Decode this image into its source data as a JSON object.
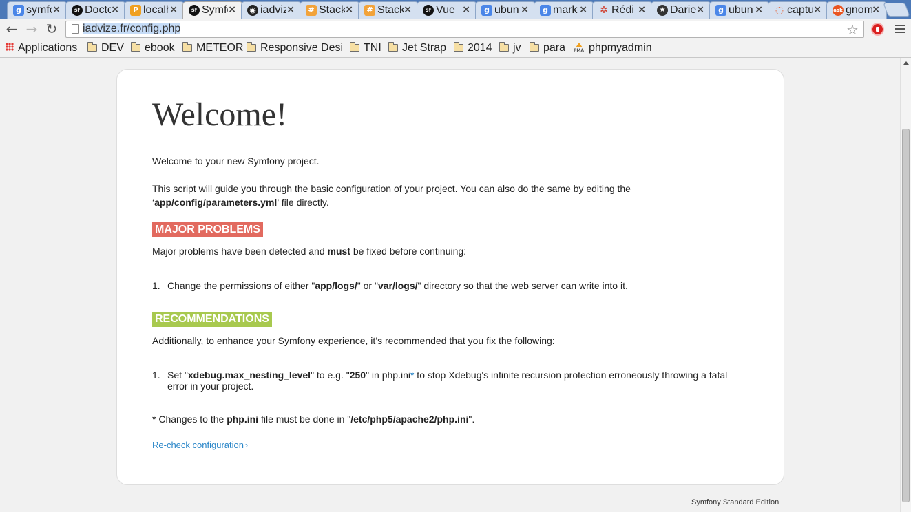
{
  "browser": {
    "tabs": [
      {
        "label": "symfo",
        "icon": "google-icon",
        "color": "#4a86e8",
        "glyph": "g"
      },
      {
        "label": "Docto",
        "icon": "symfony-icon",
        "color": "#111111",
        "glyph": "sf"
      },
      {
        "label": "localh",
        "icon": "phpmyadmin-icon",
        "color": "#f0a020",
        "glyph": "P"
      },
      {
        "label": "Symfo",
        "icon": "symfony-icon",
        "color": "#111111",
        "glyph": "sf",
        "active": true
      },
      {
        "label": "iadviz",
        "icon": "github-icon",
        "color": "#222222",
        "glyph": "◉"
      },
      {
        "label": "Stack",
        "icon": "stackoverflow-icon",
        "color": "#f2a33a",
        "glyph": "#"
      },
      {
        "label": "Stack",
        "icon": "stackoverflow-icon",
        "color": "#f2a33a",
        "glyph": "#"
      },
      {
        "label": "Vue",
        "icon": "symfony-icon",
        "color": "#111111",
        "glyph": "sf"
      },
      {
        "label": "ubun",
        "icon": "google-icon",
        "color": "#4a86e8",
        "glyph": "g"
      },
      {
        "label": "mark",
        "icon": "google-icon",
        "color": "#4a86e8",
        "glyph": "g"
      },
      {
        "label": "Rédi",
        "icon": "redis-icon",
        "color": "#d03f2f",
        "glyph": "✲"
      },
      {
        "label": "Darie",
        "icon": "star-icon",
        "color": "#333333",
        "glyph": "★"
      },
      {
        "label": "ubun",
        "icon": "google-icon",
        "color": "#4a86e8",
        "glyph": "g"
      },
      {
        "label": "captu",
        "icon": "ubuntu-icon",
        "color": "#e95420",
        "glyph": "◌"
      },
      {
        "label": "gnom",
        "icon": "askubuntu-icon",
        "color": "#e95420",
        "glyph": "ask"
      }
    ],
    "url": "iadvize.fr/config.php"
  },
  "bookmarks": [
    {
      "label": "Applications",
      "icon": "apps-icon"
    },
    {
      "label": "DEV",
      "icon": "folder-icon"
    },
    {
      "label": "ebook",
      "icon": "folder-icon"
    },
    {
      "label": "METEOR",
      "icon": "folder-icon"
    },
    {
      "label": "Responsive Desig",
      "icon": "folder-icon"
    },
    {
      "label": "TNI",
      "icon": "folder-icon"
    },
    {
      "label": "Jet Strap",
      "icon": "folder-icon"
    },
    {
      "label": "2014",
      "icon": "folder-icon"
    },
    {
      "label": "jv",
      "icon": "folder-icon"
    },
    {
      "label": "para",
      "icon": "folder-icon"
    },
    {
      "label": "phpmyadmin",
      "icon": "phpmyadmin-icon",
      "glyph": "PMA"
    }
  ],
  "page": {
    "title": "Welcome!",
    "intro": "Welcome to your new Symfony project.",
    "guide_text_1": "This script will guide you through the basic configuration of your project. You can also do the same by editing the",
    "guide_quote_open": "‘",
    "guide_file": "app/config/parameters.yml",
    "guide_text_2": "’ file directly.",
    "major": {
      "heading": "MAJOR PROBLEMS",
      "intro_1": "Major problems have been detected and ",
      "intro_bold": "must",
      "intro_2": " be fixed before continuing:",
      "items": [
        {
          "num": "1.",
          "t1": "Change the permissions of either \"",
          "b1": "app/logs/",
          "t2": "\" or \"",
          "b2": "var/logs/",
          "t3": "\" directory so that the web server can write into it."
        }
      ]
    },
    "recommendations": {
      "heading": "RECOMMENDATIONS",
      "intro": "Additionally, to enhance your Symfony experience, it’s recommended that you fix the following:",
      "items": [
        {
          "num": "1.",
          "t1": "Set \"",
          "b1": "xdebug.max_nesting_level",
          "t2": "\" to e.g. \"",
          "b2": "250",
          "t3": "\" in php.ini",
          "ast": "*",
          "t4": " to stop Xdebug's infinite recursion protection erroneously throwing a fatal error in your project."
        }
      ]
    },
    "note": {
      "t1": "* Changes to the ",
      "b1": "php.ini",
      "t2": " file must be done in \"",
      "b2": "/etc/php5/apache2/php.ini",
      "t3": "\"."
    },
    "recheck_label": "Re-check configuration",
    "recheck_chevron": "›",
    "footer": "Symfony Standard Edition"
  }
}
